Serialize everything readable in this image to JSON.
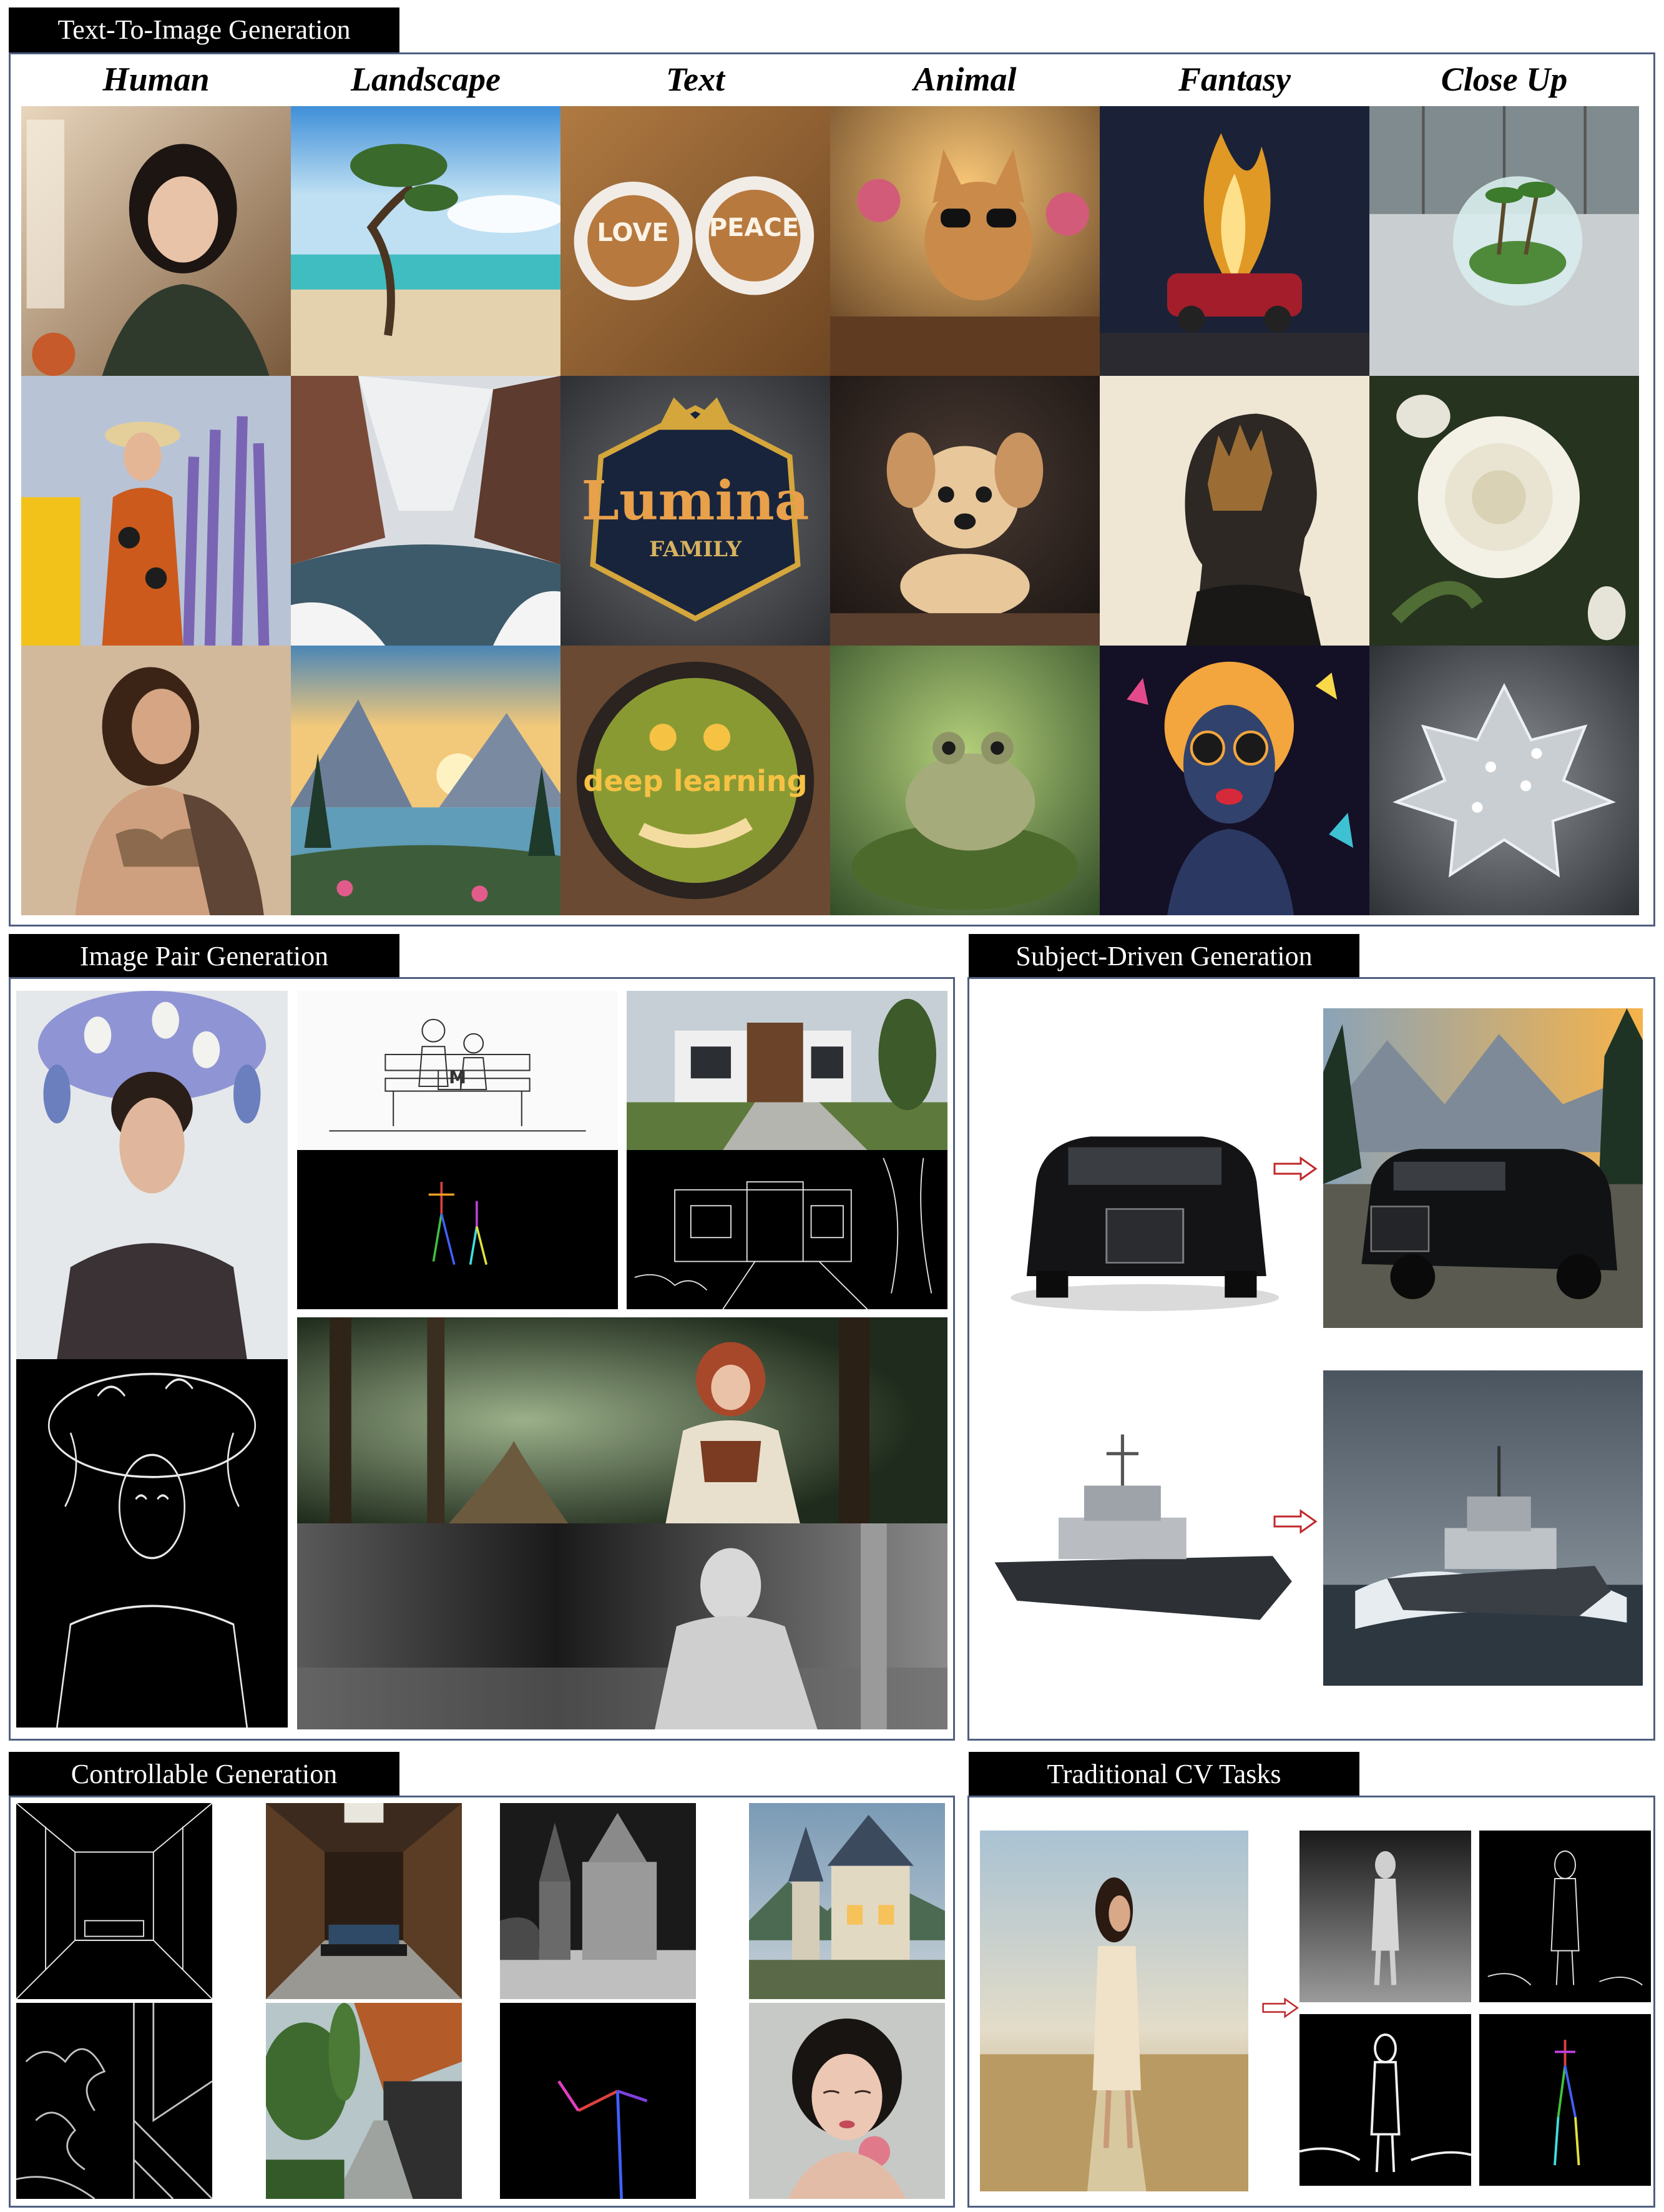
{
  "sections": {
    "t2i": "Text-To-Image Generation",
    "pair": "Image Pair Generation",
    "subject": "Subject-Driven Generation",
    "control": "Controllable Generation",
    "cv": "Traditional CV Tasks"
  },
  "categories": [
    "Human",
    "Landscape",
    "Text",
    "Animal",
    "Fantasy",
    "Close Up"
  ],
  "image_text": {
    "love": "LOVE",
    "peace": "PEACE",
    "lumina": "Lumina",
    "family": "FAMILY",
    "deep_learning": "deep learning",
    "bench_letter": "M"
  },
  "colors": {
    "frame_border": "#4f5f7f",
    "tag_bg": "#000000",
    "tag_text": "#ffffff",
    "arrow": "#c0282b"
  }
}
